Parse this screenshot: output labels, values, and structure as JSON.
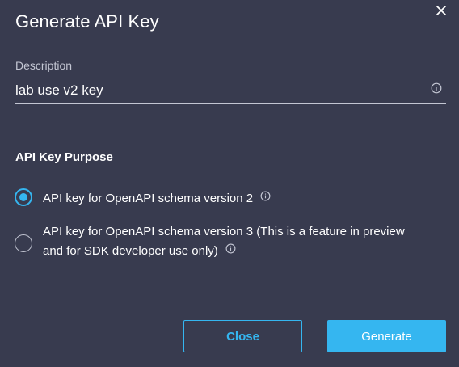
{
  "dialog": {
    "title": "Generate API Key",
    "close_icon": "close-icon"
  },
  "description": {
    "label": "Description",
    "value": "lab use v2 key",
    "info_icon": "info-icon"
  },
  "purpose": {
    "title": "API Key Purpose",
    "options": [
      {
        "line1": "API key for OpenAPI schema version 2",
        "line2": "",
        "selected": true
      },
      {
        "line1": "API key for OpenAPI schema version 3 (This is a feature in preview",
        "line2": "and for SDK developer use only)",
        "selected": false
      }
    ]
  },
  "buttons": {
    "close_label": "Close",
    "generate_label": "Generate"
  },
  "colors": {
    "background": "#383b4f",
    "accent": "#35b6f0",
    "muted_text": "#c3c6d3"
  }
}
